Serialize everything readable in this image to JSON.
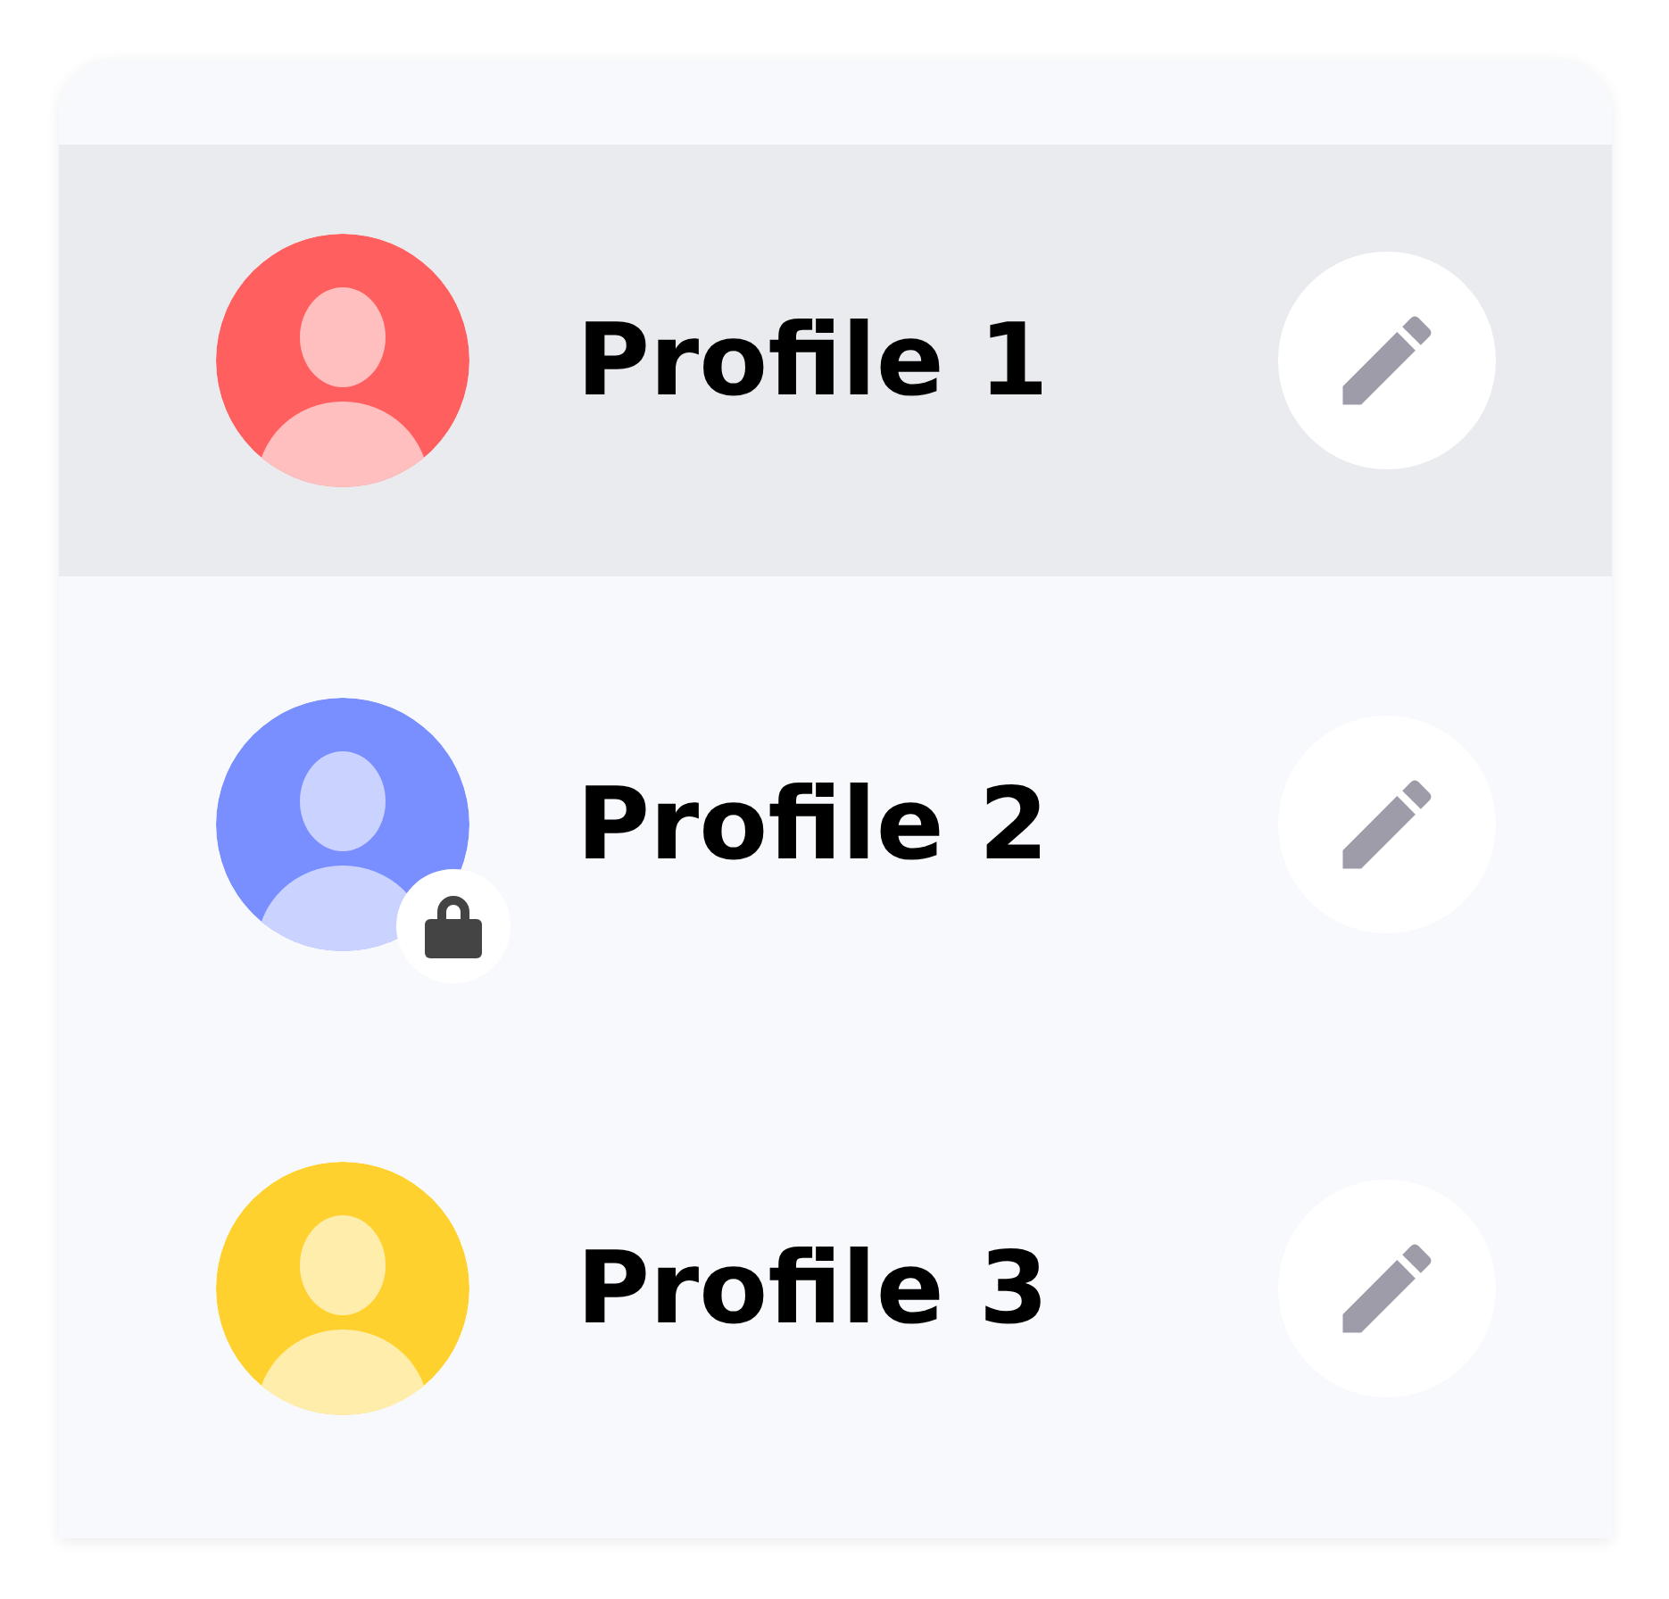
{
  "profiles": [
    {
      "name": "Profile 1",
      "color": "#ff5f5f",
      "selected": true,
      "locked": false
    },
    {
      "name": "Profile 2",
      "color": "#7a8fff",
      "selected": false,
      "locked": true
    },
    {
      "name": "Profile 3",
      "color": "#ffd12e",
      "selected": false,
      "locked": false
    }
  ]
}
